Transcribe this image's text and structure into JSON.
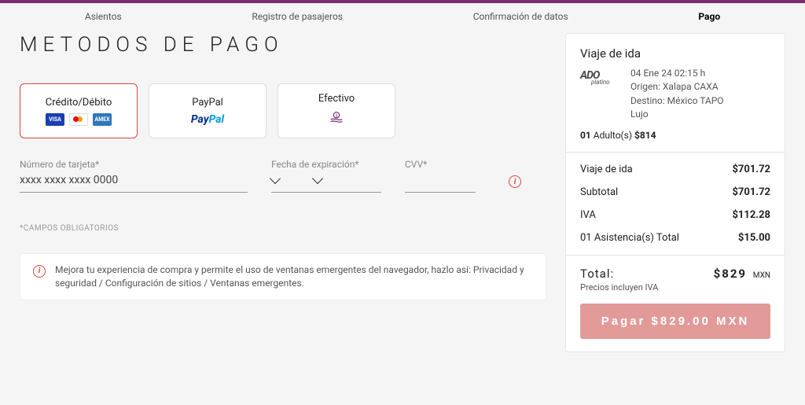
{
  "steps": {
    "items": [
      "Asientos",
      "Registro de pasajeros",
      "Confirmación de datos",
      "Pago"
    ],
    "active_index": 3
  },
  "page_title": "METODOS DE PAGO",
  "methods": {
    "card": "Crédito/Débito",
    "paypal": "PayPal",
    "cash": "Efectivo"
  },
  "form": {
    "card_label": "Número de tarjeta*",
    "card_placeholder": "xxxx xxxx xxxx 0000",
    "exp_label": "Fecha de expiración*",
    "cvv_label": "CVV*"
  },
  "required_note": "*CAMPOS OBLIGATORIOS",
  "banner_text": "Mejora tu experiencia de compra y permite el uso de ventanas emergentes del navegador, hazlo así: Privacidad y seguridad / Configuración de sitios / Ventanas emergentes.",
  "summary": {
    "trip_title": "Viaje de ida",
    "datetime": "04 Ene 24 02:15 h",
    "origin": "Origen: Xalapa CAXA",
    "destination": "Destino: México TAPO",
    "class": "Lujo",
    "pax_count": "01",
    "pax_label": "Adulto(s)",
    "pax_price": "$814",
    "rows": [
      {
        "label": "Viaje de ida",
        "value": "$701.72"
      },
      {
        "label": "Subtotal",
        "value": "$701.72"
      },
      {
        "label": "IVA",
        "value": "$112.28"
      },
      {
        "label": "01 Asistencia(s) Total",
        "value": "$15.00"
      }
    ],
    "total_label": "Total:",
    "total_value": "$829",
    "total_currency": "MXN",
    "tax_note": "Precios incluyen IVA",
    "pay_button": "Pagar $829.00 MXN"
  }
}
